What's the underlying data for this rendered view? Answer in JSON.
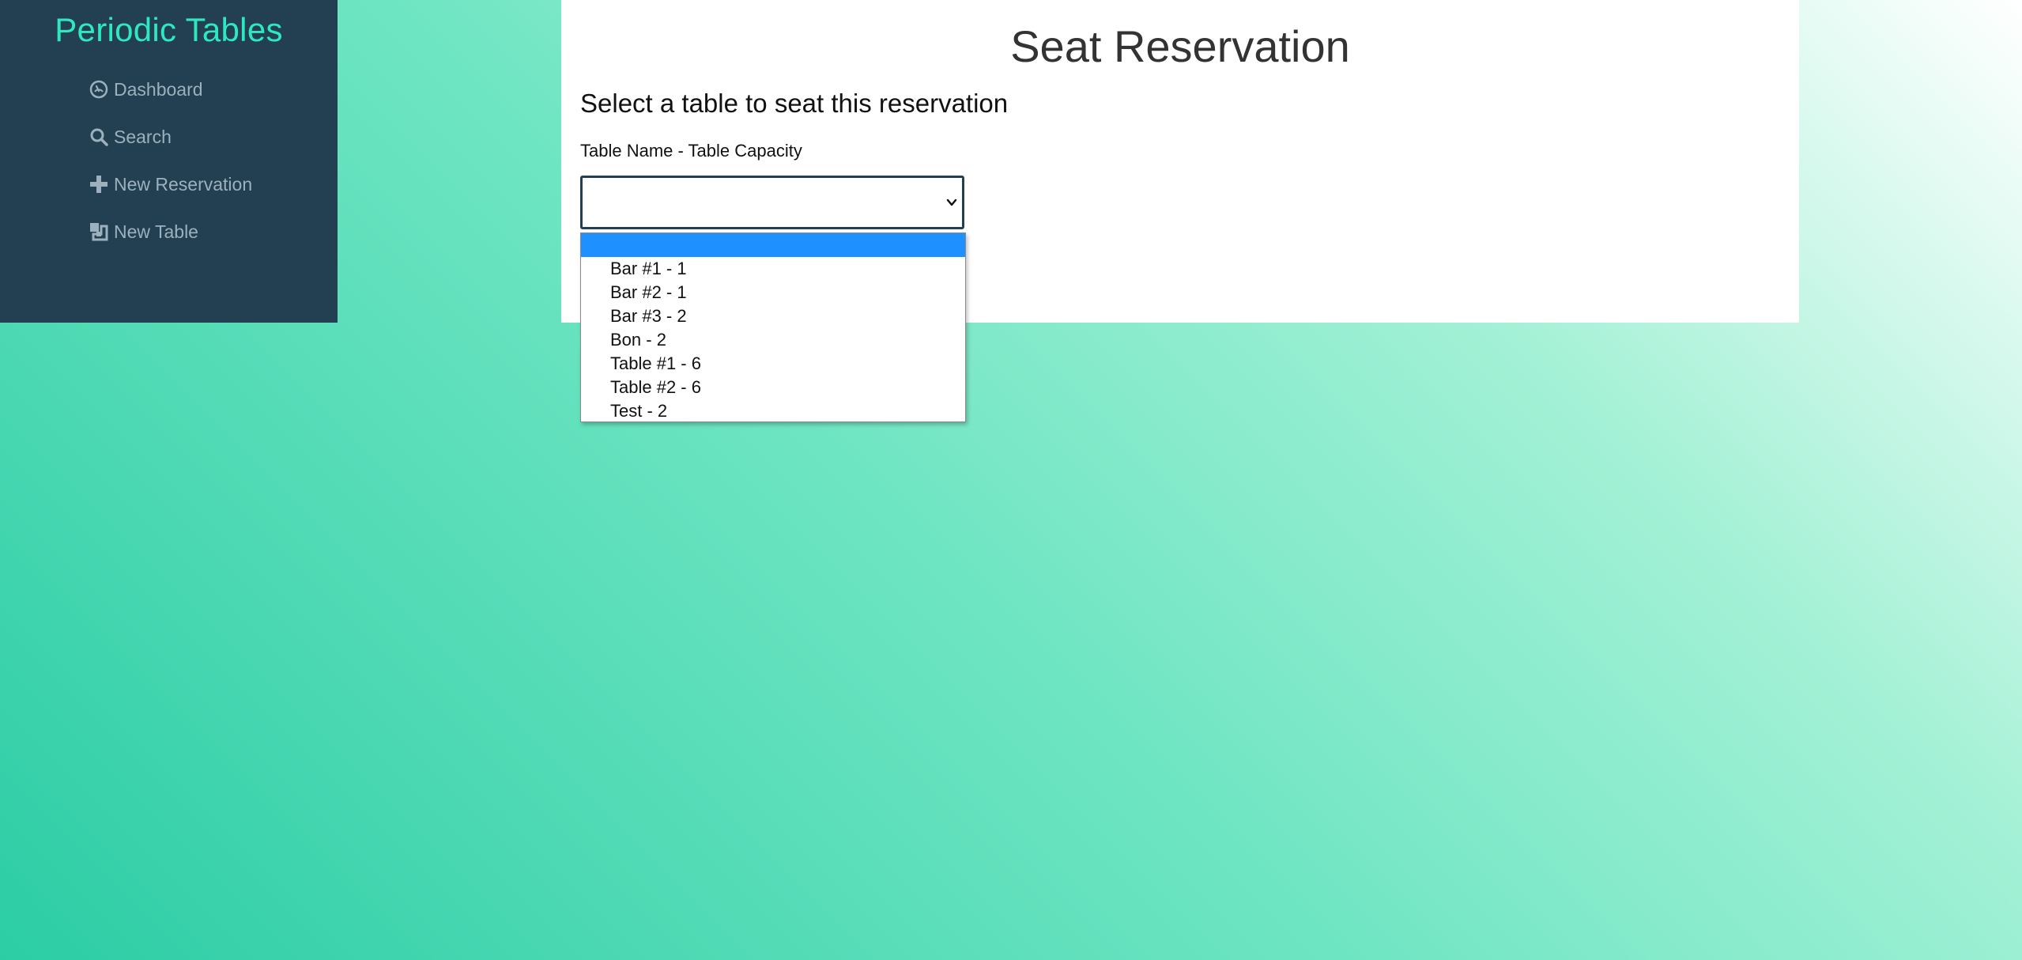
{
  "app": {
    "brand": "Periodic Tables"
  },
  "sidebar": {
    "items": [
      {
        "label": "Dashboard",
        "icon": "dashboard-icon"
      },
      {
        "label": "Search",
        "icon": "search-icon"
      },
      {
        "label": "New Reservation",
        "icon": "plus-icon"
      },
      {
        "label": "New Table",
        "icon": "table-icon"
      }
    ]
  },
  "main": {
    "title": "Seat Reservation",
    "subtitle": "Select a table to seat this reservation",
    "table_field": {
      "label": "Table Name - Table Capacity",
      "value": "",
      "options": [
        "",
        "Bar #1 - 1",
        "Bar #2 - 1",
        "Bar #3 - 2",
        "Bon - 2",
        "Table #1 - 6",
        "Table #2 - 6",
        "Test - 2"
      ],
      "highlighted_option": ""
    }
  },
  "colors": {
    "sidebar_bg": "#234052",
    "brand": "#2ee8c2",
    "nav_text": "#9cb0bd",
    "highlight": "#1e90ff",
    "background_start": "#2ccda5",
    "background_end": "#ffffff"
  }
}
